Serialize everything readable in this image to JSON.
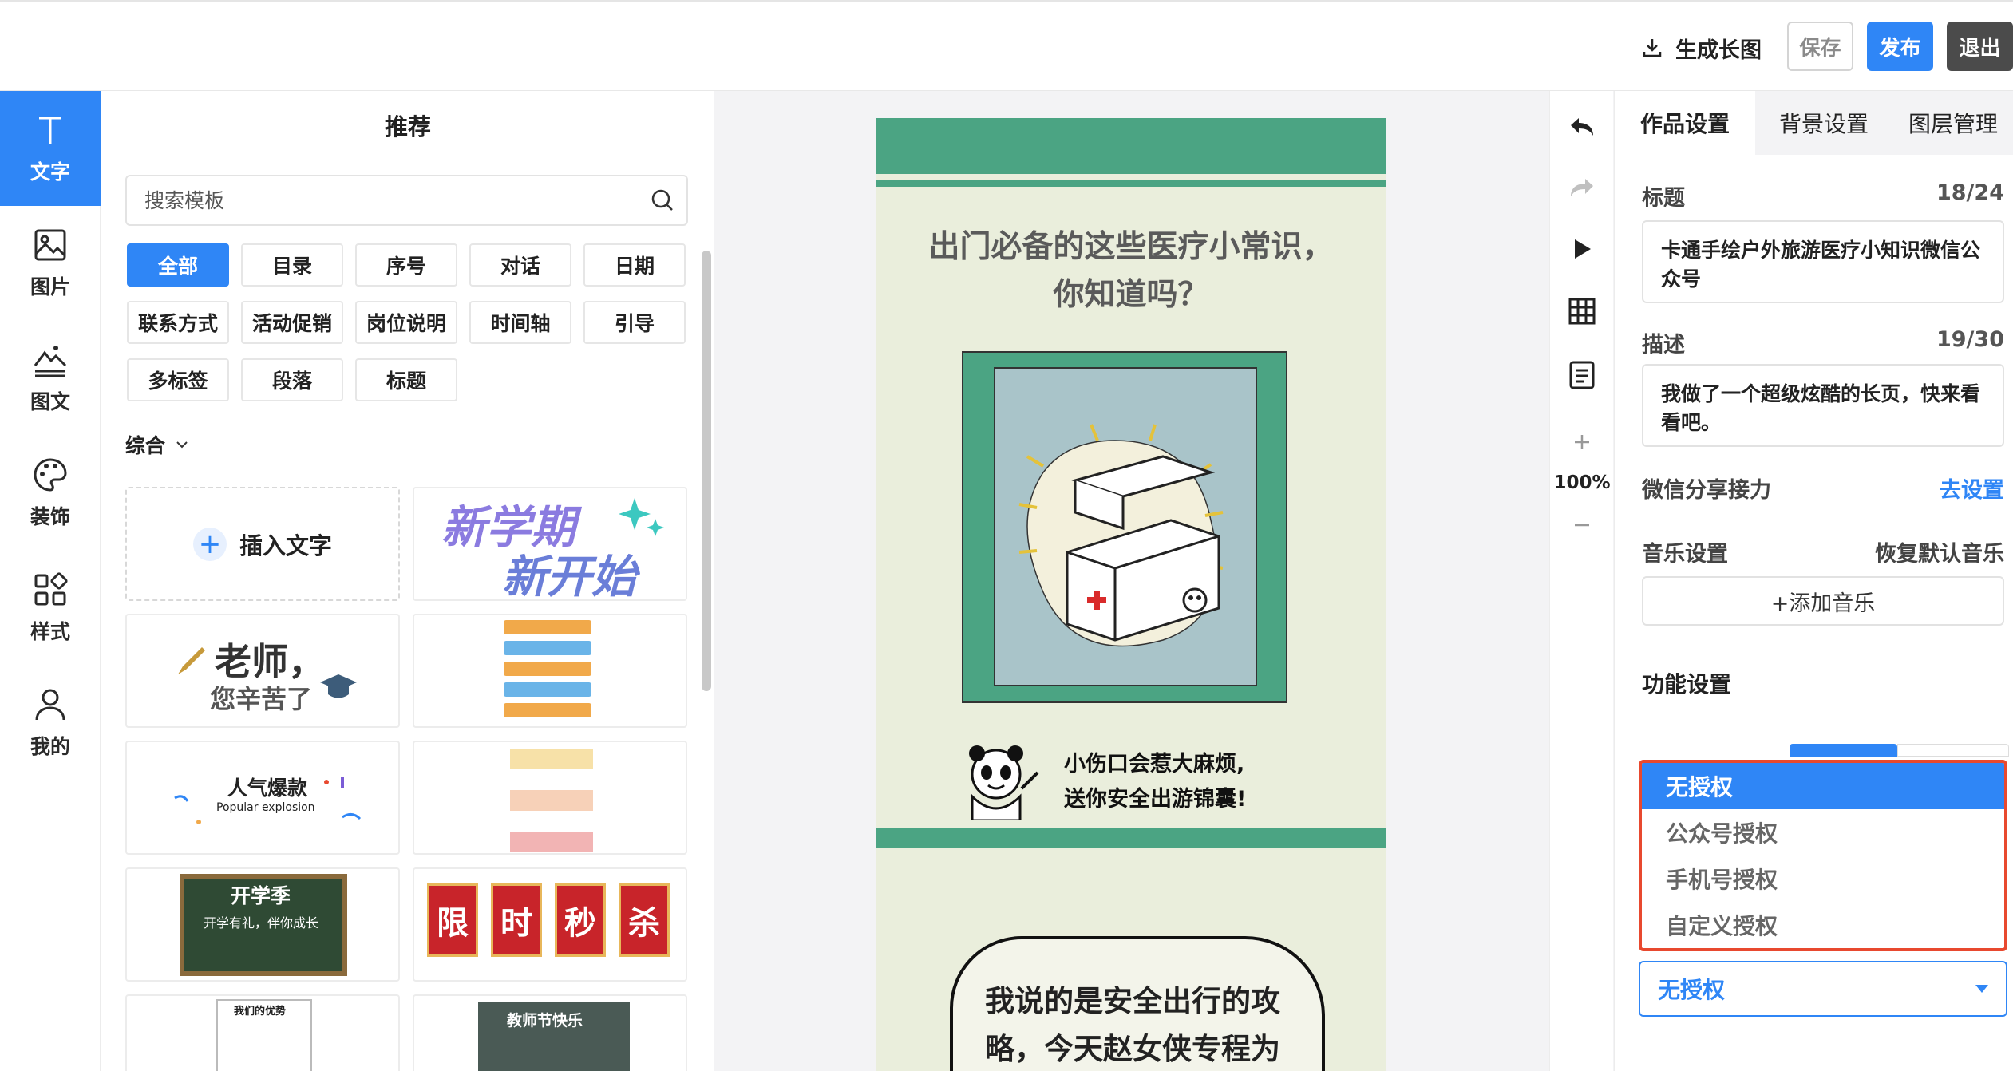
{
  "topbar": {
    "export_label": "生成长图",
    "save_label": "保存",
    "publish_label": "发布",
    "exit_label": "退出"
  },
  "leftbar": {
    "items": [
      {
        "label": "文字",
        "icon": "text-icon"
      },
      {
        "label": "图片",
        "icon": "image-icon"
      },
      {
        "label": "图文",
        "icon": "image-text-icon"
      },
      {
        "label": "装饰",
        "icon": "palette-icon"
      },
      {
        "label": "样式",
        "icon": "style-grid-icon"
      },
      {
        "label": "我的",
        "icon": "user-icon"
      }
    ]
  },
  "panel": {
    "title": "推荐",
    "search_placeholder": "搜索模板",
    "tags": [
      "全部",
      "目录",
      "序号",
      "对话",
      "日期",
      "联系方式",
      "活动促销",
      "岗位说明",
      "时间轴",
      "引导",
      "多标签",
      "段落",
      "标题"
    ],
    "filter_label": "综合",
    "insert_text_label": "插入文字",
    "cards": [
      {
        "line1": "新学期",
        "line2": "新开始"
      },
      {
        "line1": "老师，",
        "line2": "您辛苦了"
      },
      {
        "line1": "人气爆款",
        "line2": "Popular explosion"
      },
      {
        "line1": "开学季",
        "line2": "开学有礼，伴你成长"
      },
      {
        "chars": [
          "限",
          "时",
          "秒",
          "杀"
        ]
      },
      {
        "line1": "我们的优势",
        "line2": "教师节快乐"
      }
    ]
  },
  "canvas_page": {
    "title": "出门必备的这些医疗小常识，\n你知道吗？",
    "caption": "小伤口会惹大麻烦,\n送你安全出游锦囊!",
    "bubble": "我说的是安全出行的攻\n略，今天赵女侠专程为"
  },
  "tools": {
    "zoom": "100%"
  },
  "rpanel": {
    "tabs": [
      "作品设置",
      "背景设置",
      "图层管理"
    ],
    "title_label": "标题",
    "title_count": "18/24",
    "title_value": "卡通手绘户外旅游医疗小知识微信公众号",
    "desc_label": "描述",
    "desc_count": "19/30",
    "desc_value": "我做了一个超级炫酷的长页，快来看看吧。",
    "wechat_label": "微信分享接力",
    "wechat_action": "去设置",
    "music_label": "音乐设置",
    "music_action": "恢复默认音乐",
    "add_music": "+添加音乐",
    "func_title": "功能设置",
    "auth_options": [
      "无授权",
      "公众号授权",
      "手机号授权",
      "自定义授权"
    ],
    "auth_selected": "无授权"
  },
  "colors": {
    "accent": "#2f86f6",
    "page_green": "#4ba483",
    "page_bg": "#eaeedc",
    "highlight": "#e8492f"
  }
}
